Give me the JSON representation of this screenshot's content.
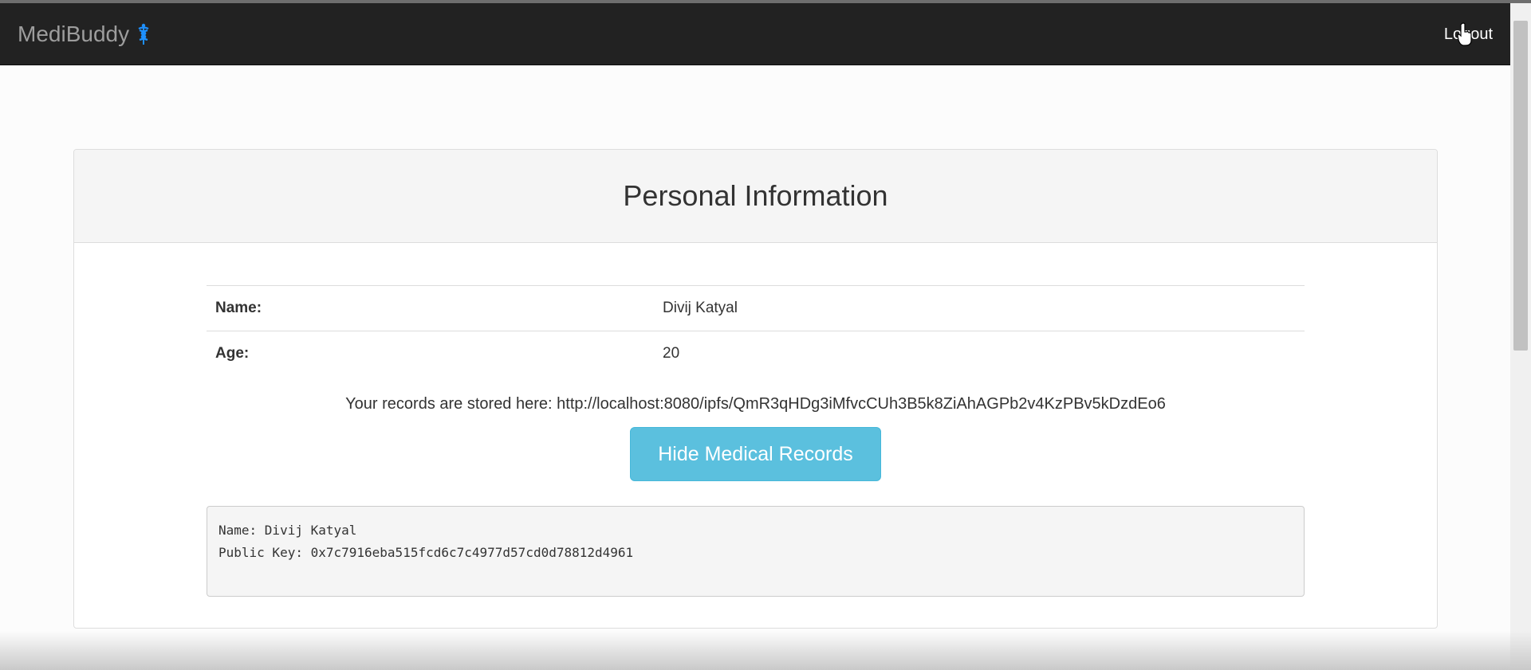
{
  "navbar": {
    "brand_label": "MediBuddy",
    "brand_icon": "caduceus-icon",
    "brand_icon_color": "#1e90ff",
    "logout_label": "Logout"
  },
  "panel": {
    "title": "Personal Information",
    "rows": [
      {
        "label": "Name:",
        "value": "Divij Katyal"
      },
      {
        "label": "Age:",
        "value": "20"
      }
    ],
    "records_text": "Your records are stored here: http://localhost:8080/ipfs/QmR3qHDg3iMfvcCUh3B5k8ZiAhAGPb2v4KzPBv5kDzdEo6",
    "toggle_button_label": "Hide Medical Records",
    "record_lines": [
      "Name: Divij Katyal",
      "Public Key: 0x7c7916eba515fcd6c7c4977d57cd0d78812d4961"
    ]
  },
  "colors": {
    "navbar_bg": "#222222",
    "button_bg": "#5bc0de"
  }
}
